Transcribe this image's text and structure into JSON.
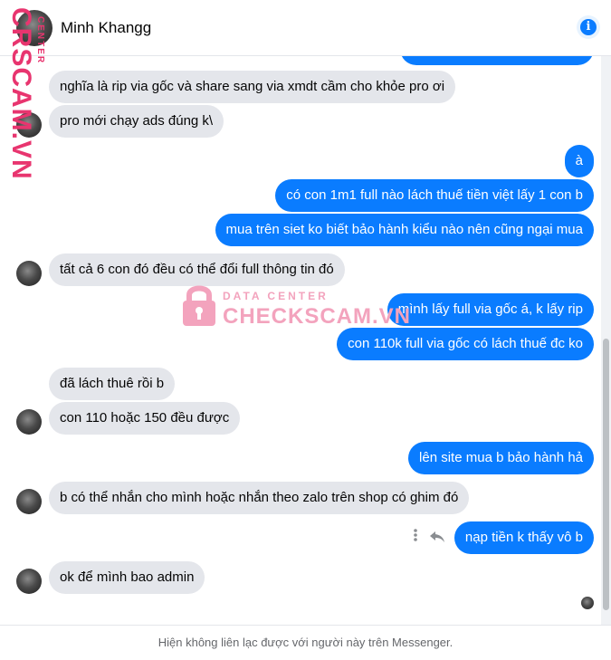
{
  "header": {
    "contact_name": "Minh Khangg"
  },
  "watermark": {
    "side_big": "CRSCAM.VN",
    "side_small": "CENTER",
    "center_top": "DATA CENTER",
    "center_bottom": "CHECKSCAM.VN"
  },
  "messages": [
    {
      "from": "contact",
      "text": "nghĩa là rip via gốc và share sang via xmdt cầm cho khỏe pro ơi"
    },
    {
      "from": "contact",
      "text": "pro mới chạy ads đúng k\\"
    },
    {
      "from": "me",
      "text": "à"
    },
    {
      "from": "me",
      "text": "có con 1m1 full nào lách thuế tiền việt lấy 1 con b"
    },
    {
      "from": "me",
      "text": "mua trên siet ko biết bảo hành kiểu nào nên cũng ngại mua"
    },
    {
      "from": "contact",
      "text": "tất cả 6 con đó đều có thể đổi full thông tin đó"
    },
    {
      "from": "me",
      "text": "mình lấy full via gốc á, k lấy rip"
    },
    {
      "from": "me",
      "text": "con 110k full via gốc có lách thuế đc ko"
    },
    {
      "from": "contact",
      "text": "đã lách thuê rồi b"
    },
    {
      "from": "contact",
      "text": "con 110 hoặc 150 đều được"
    },
    {
      "from": "me",
      "text": "lên site mua b bảo hành hả"
    },
    {
      "from": "contact",
      "text": "b có thể nhắn cho mình hoặc nhắn theo zalo trên shop có ghim đó"
    },
    {
      "from": "me",
      "text": "nạp tiền k thấy vô b"
    },
    {
      "from": "contact",
      "text": "ok để mình bao admin"
    }
  ],
  "footer": {
    "notice": "Hiện không liên lạc được với người này trên Messenger."
  },
  "colors": {
    "outgoing_bubble": "#0a7cff",
    "incoming_bubble": "#e4e6eb",
    "watermark": "#e8356f"
  },
  "icons": [
    "info-icon",
    "more-vertical-icon",
    "reply-icon"
  ]
}
